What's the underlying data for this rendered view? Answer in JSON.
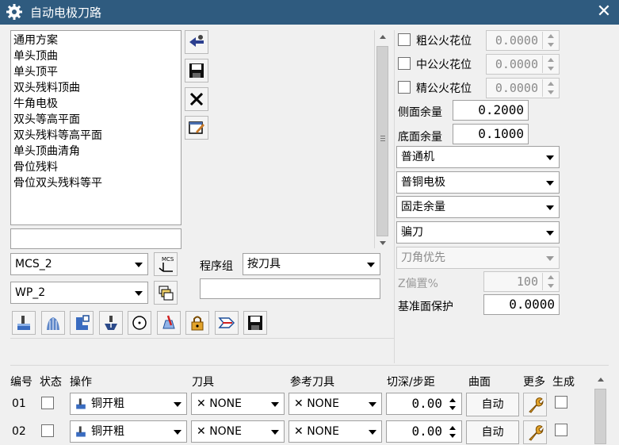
{
  "window": {
    "title": "自动电极刀路",
    "close_glyph": "✕"
  },
  "plan_list": {
    "items": [
      "通用方案",
      "单头顶曲",
      "单头顶平",
      "双头残料顶曲",
      "牛角电极",
      "双头等高平面",
      "双头残料等高平面",
      "单头顶曲清角",
      "骨位残料",
      "骨位双头残料等平"
    ],
    "filter_value": ""
  },
  "side_tools": [
    "import-icon",
    "save-icon",
    "delete-icon",
    "edit-icon"
  ],
  "mcs": {
    "value": "MCS_2",
    "icon_caption": "MCS"
  },
  "wp": {
    "value": "WP_2"
  },
  "program_group": {
    "label": "程序组",
    "value": "按刀具",
    "name_value": ""
  },
  "toolbar_icons": [
    "rough-mill-icon",
    "finish-mill-icon",
    "corner-icon",
    "plunge-icon",
    "circle-target-icon",
    "clear-icon",
    "lock-icon",
    "auto-arrow-icon",
    "save-icon"
  ],
  "spark_gaps": [
    {
      "label": "粗公火花位",
      "value": "0.0000",
      "checked": false
    },
    {
      "label": "中公火花位",
      "value": "0.0000",
      "checked": false
    },
    {
      "label": "精公火花位",
      "value": "0.0000",
      "checked": false
    }
  ],
  "side_stock": {
    "label": "侧面余量",
    "value": "0.2000"
  },
  "bottom_stock": {
    "label": "底面余量",
    "value": "0.1000"
  },
  "selects": {
    "machine": "普通机",
    "electrode_type": "普铜电极",
    "stock_mode": "固走余量",
    "cutter": "骗刀",
    "priority": "刀角优先"
  },
  "z_offset": {
    "label": "Z偏置%",
    "value": "100"
  },
  "base_protect": {
    "label": "基准面保护",
    "value": "0.0000"
  },
  "table": {
    "headers": {
      "num": "编号",
      "status": "状态",
      "op": "操作",
      "tool": "刀具",
      "ref_tool": "参考刀具",
      "depth": "切深/步距",
      "surface": "曲面",
      "more": "更多",
      "gen": "生成"
    },
    "rows": [
      {
        "num": "01",
        "op": "铜开粗",
        "tool": "NONE",
        "ref_tool": "NONE",
        "depth": "0.00",
        "surface": "自动"
      },
      {
        "num": "02",
        "op": "铜开粗",
        "tool": "NONE",
        "ref_tool": "NONE",
        "depth": "0.00",
        "surface": "自动"
      }
    ],
    "none_glyph": "✕"
  },
  "colors": {
    "titlebar": "#2f5b7f",
    "background": "#f0f0f0",
    "accent_blue": "#1f4f9a"
  }
}
